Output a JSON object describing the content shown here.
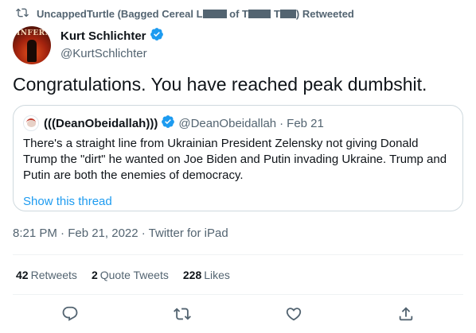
{
  "retweet": {
    "icon": "retweet-icon",
    "user_prefix": "UncappedTurtle (Bagged Cereal L",
    "user_mid": " of T",
    "user_suffix": ") Retweeted"
  },
  "author": {
    "name": "Kurt Schlichter",
    "handle": "@KurtSchlichter",
    "verified": true,
    "avatar_label": "INFERNO"
  },
  "tweet": {
    "text": "Congratulations. You have reached peak dumbshit."
  },
  "quote": {
    "name": "(((DeanObeidallah)))",
    "handle": "@DeanObeidallah",
    "separator": " · ",
    "date": "Feb 21",
    "verified": true,
    "text": "There's a straight line from Ukrainian President Zelensky not giving Donald Trump the \"dirt\" he wanted on Joe Biden and Putin invading Ukraine.  Trump and Putin are both the enemies of democracy.",
    "show_thread": "Show this thread"
  },
  "meta": {
    "timestamp": "8:21 PM · Feb 21, 2022 · Twitter for iPad"
  },
  "stats": {
    "retweets_count": "42",
    "retweets_label": "Retweets",
    "quotes_count": "2",
    "quotes_label": "Quote Tweets",
    "likes_count": "228",
    "likes_label": "Likes"
  },
  "actions": [
    "reply-icon",
    "retweet-icon",
    "like-icon",
    "share-icon"
  ],
  "colors": {
    "accent": "#1d9bf0",
    "text": "#0f1419",
    "muted": "#536471",
    "border": "#cfd9de"
  }
}
